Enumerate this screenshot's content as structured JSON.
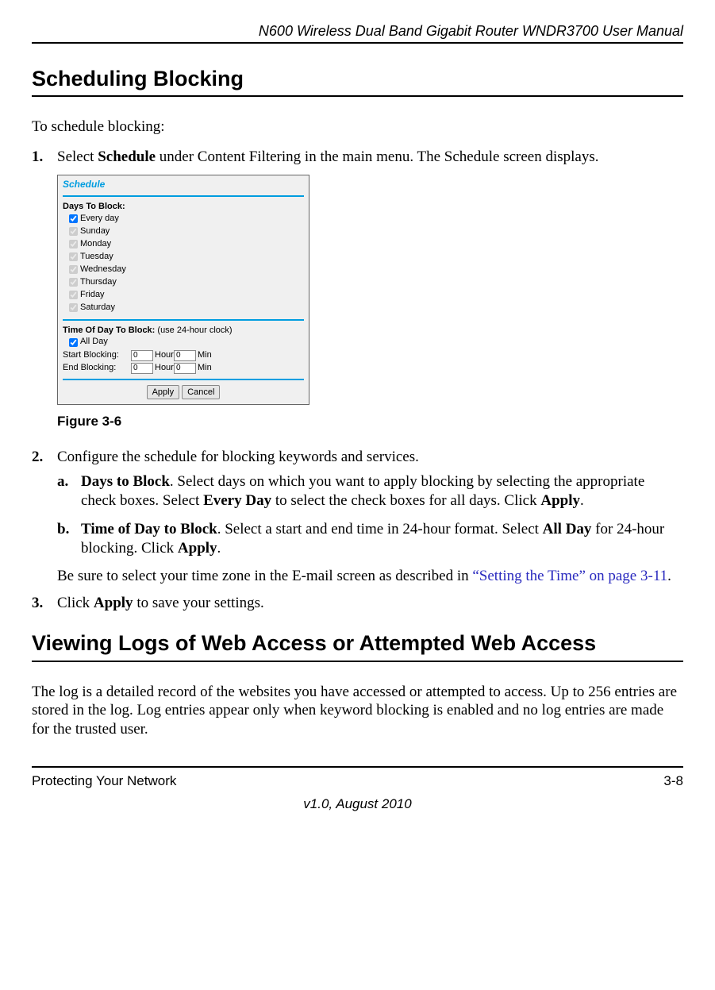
{
  "running_head": "N600 Wireless Dual Band Gigabit Router WNDR3700 User Manual",
  "h1_a": "Scheduling Blocking",
  "intro_a": "To schedule blocking:",
  "step1_num": "1.",
  "step1_pre": "Select ",
  "step1_bold": "Schedule",
  "step1_post": " under Content Filtering in the main menu. The Schedule screen displays.",
  "shot": {
    "title": "Schedule",
    "days_label": "Days To Block:",
    "days": [
      "Every day",
      "Sunday",
      "Monday",
      "Tuesday",
      "Wednesday",
      "Thursday",
      "Friday",
      "Saturday"
    ],
    "time_label": "Time Of Day To Block:",
    "time_hint": " (use 24-hour clock)",
    "allday": "All Day",
    "start_label": "Start Blocking:",
    "end_label": "End Blocking:",
    "start_hour": "0",
    "start_min": "0",
    "end_hour": "0",
    "end_min": "0",
    "hour_unit": "Hour",
    "min_unit": "Min",
    "apply": "Apply",
    "cancel": "Cancel"
  },
  "fig_caption": "Figure 3-6",
  "step2_num": "2.",
  "step2_text": "Configure the schedule for blocking keywords and services.",
  "step2a_num": "a.",
  "step2a_b1": "Days to Block",
  "step2a_t1": ". Select days on which you want to apply blocking by selecting the appropriate check boxes. Select ",
  "step2a_b2": "Every Day",
  "step2a_t2": " to select the check boxes for all days. Click ",
  "step2a_b3": "Apply",
  "step2a_t3": ".",
  "step2b_num": "b.",
  "step2b_b1": "Time of Day to Block",
  "step2b_t1": ". Select a start and end time in 24-hour format. Select ",
  "step2b_b2": "All Day",
  "step2b_t2": " for 24-hour blocking. Click ",
  "step2b_b3": "Apply",
  "step2b_t3": ".",
  "tz_t1": "Be sure to select your time zone in the E-mail screen as described in ",
  "tz_link": "“Setting the Time” on page 3-11",
  "tz_t2": ".",
  "step3_num": "3.",
  "step3_t1": "Click ",
  "step3_b1": "Apply",
  "step3_t2": " to save your settings.",
  "h1_b": "Viewing Logs of Web Access or Attempted Web Access",
  "logs_para": "The log is a detailed record of the websites you have accessed or attempted to access. Up to 256 entries are stored in the log. Log entries appear only when keyword blocking is enabled and no log entries are made for the trusted user.",
  "footer_left": "Protecting Your Network",
  "footer_right": "3-8",
  "version": "v1.0, August 2010"
}
